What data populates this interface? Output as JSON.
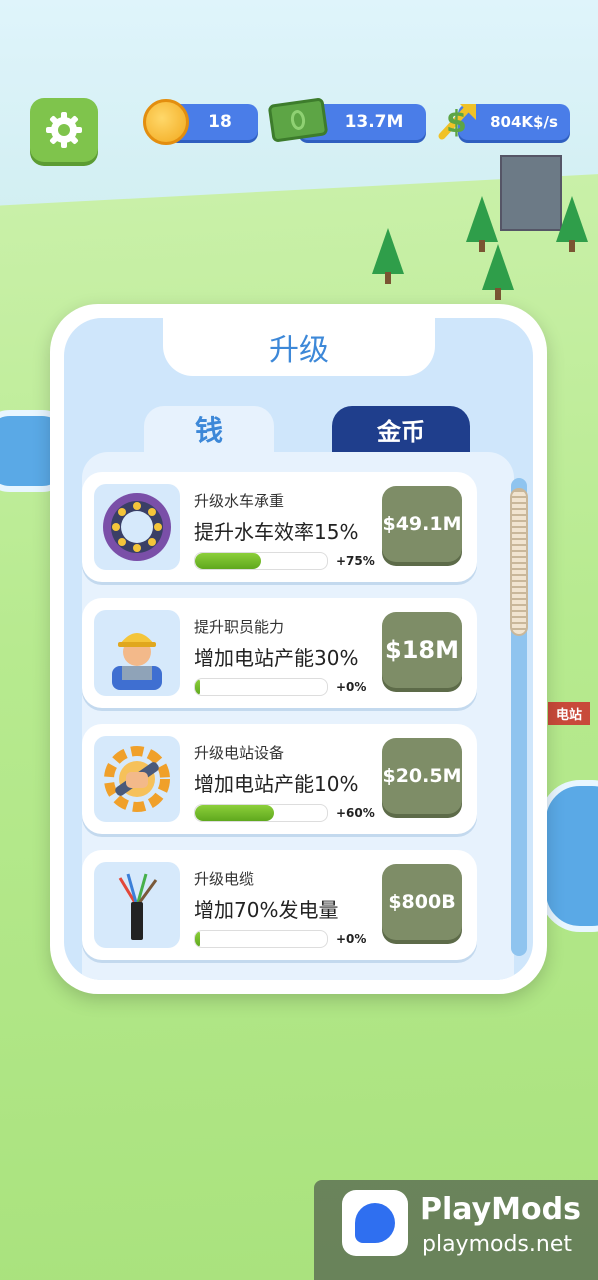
{
  "hud": {
    "coins": "18",
    "cash": "13.7M",
    "income_rate": "804K$/s"
  },
  "scene": {
    "station_label": "电站"
  },
  "panel": {
    "title": "升级",
    "tabs": [
      {
        "label": "钱",
        "active": true
      },
      {
        "label": "金币",
        "active": false
      }
    ],
    "items": [
      {
        "title": "升级水车承重",
        "desc": "提升水车效率15%",
        "progress": 0.5,
        "percent": "+75%",
        "price": "$49.1M",
        "icon": "bearing-icon"
      },
      {
        "title": "提升职员能力",
        "desc": "增加电站产能30%",
        "progress": 0.04,
        "percent": "+0%",
        "price": "$18M",
        "icon": "worker-icon"
      },
      {
        "title": "升级电站设备",
        "desc": "增加电站产能10%",
        "progress": 0.6,
        "percent": "+60%",
        "price": "$20.5M",
        "icon": "gear-wrench-icon"
      },
      {
        "title": "升级电缆",
        "desc": "增加70%发电量",
        "progress": 0.04,
        "percent": "+0%",
        "price": "$800B",
        "icon": "cable-icon"
      }
    ]
  },
  "watermark": {
    "name": "PlayMods",
    "url": "playmods.net"
  },
  "colors": {
    "accent": "#3d88d8",
    "tab_dark": "#1f3e8c",
    "price_button": "#7e8d67",
    "progress": "#6fb82a"
  }
}
